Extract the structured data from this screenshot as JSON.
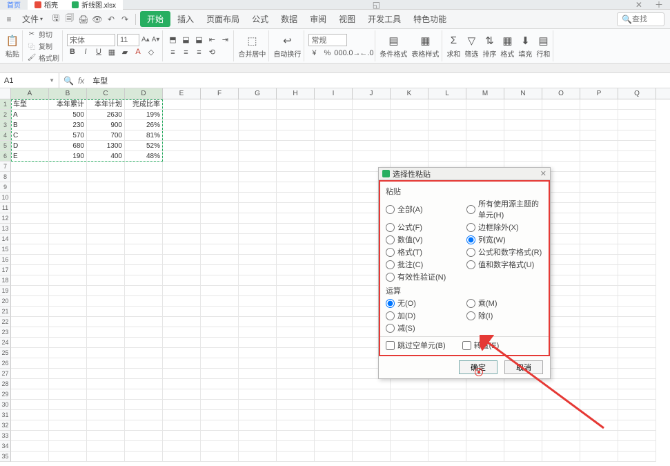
{
  "tabs": {
    "home": "首页",
    "doc1": "稻壳",
    "doc2": "折线图.xlsx"
  },
  "menu": {
    "file": "文件",
    "start": "开始",
    "insert": "插入",
    "pagelayout": "页面布局",
    "formula": "公式",
    "data": "数据",
    "review": "审阅",
    "view": "视图",
    "devtools": "开发工具",
    "special": "特色功能",
    "search_placeholder": "查找"
  },
  "ribbon": {
    "paste": "粘贴",
    "cut": "剪切",
    "copy": "复制",
    "formatpainter": "格式刷",
    "font_name": "宋体",
    "font_size": "11",
    "merge": "合并居中",
    "wrap": "自动换行",
    "numfmt": "常规",
    "condfmt": "条件格式",
    "tblstyle": "表格样式",
    "sum": "求和",
    "filter": "筛选",
    "sort": "排序",
    "format": "格式",
    "fill": "填充",
    "rowcol": "行和"
  },
  "namebox": "A1",
  "formula_value": "车型",
  "columns": [
    "A",
    "B",
    "C",
    "D",
    "E",
    "F",
    "G",
    "H",
    "I",
    "J",
    "K",
    "L",
    "M",
    "N",
    "O",
    "P",
    "Q"
  ],
  "table": {
    "headers": [
      "车型",
      "本年累计",
      "本年计划",
      "完成比率"
    ],
    "rows": [
      {
        "model": "A",
        "acc": "500",
        "plan": "2630",
        "rate": "19%"
      },
      {
        "model": "B",
        "acc": "230",
        "plan": "900",
        "rate": "26%"
      },
      {
        "model": "C",
        "acc": "570",
        "plan": "700",
        "rate": "81%"
      },
      {
        "model": "D",
        "acc": "680",
        "plan": "1300",
        "rate": "52%"
      },
      {
        "model": "E",
        "acc": "190",
        "plan": "400",
        "rate": "48%"
      }
    ]
  },
  "row_count_empty": 29,
  "dialog": {
    "title": "选择性粘贴",
    "section_paste": "粘贴",
    "opts_paste_left": [
      "全部(A)",
      "公式(F)",
      "数值(V)",
      "格式(T)",
      "批注(C)",
      "有效性验证(N)"
    ],
    "opts_paste_right": [
      "所有使用源主题的单元(H)",
      "边框除外(X)",
      "列宽(W)",
      "公式和数字格式(R)",
      "值和数字格式(U)"
    ],
    "paste_selected": "列宽(W)",
    "section_calc": "运算",
    "opts_calc_left": [
      "无(O)",
      "加(D)",
      "减(S)"
    ],
    "opts_calc_right": [
      "乘(M)",
      "除(I)"
    ],
    "calc_selected": "无(O)",
    "check_skip": "跳过空单元(B)",
    "check_transpose": "转置(E)",
    "ok": "确定",
    "cancel": "取消"
  }
}
